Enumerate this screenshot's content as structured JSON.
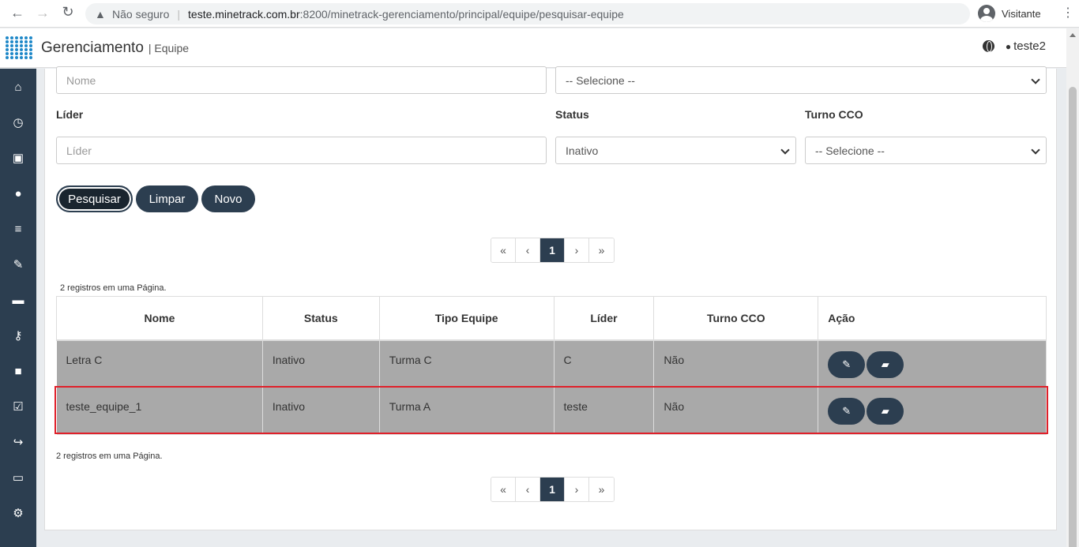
{
  "browser": {
    "security": "Não seguro",
    "url_host": "teste.minetrack.com.br",
    "url_path": ":8200/minetrack-gerenciamento/principal/equipe/pesquisar-equipe",
    "profile": "Visitante"
  },
  "header": {
    "title": "Gerenciamento",
    "subtitle": "| Equipe",
    "user": "teste2"
  },
  "sidebar": {
    "items": [
      {
        "icon": "home-icon",
        "glyph": "⌂"
      },
      {
        "icon": "clock-icon",
        "glyph": "◷"
      },
      {
        "icon": "bus-icon",
        "glyph": "▣"
      },
      {
        "icon": "user-icon",
        "glyph": "●"
      },
      {
        "icon": "menu-icon",
        "glyph": "≡"
      },
      {
        "icon": "wrench-icon",
        "glyph": "✎"
      },
      {
        "icon": "archive-icon",
        "glyph": "▬"
      },
      {
        "icon": "key-icon",
        "glyph": "⚷"
      },
      {
        "icon": "lock-icon",
        "glyph": "■"
      },
      {
        "icon": "check-square-icon",
        "glyph": "☑"
      },
      {
        "icon": "share-icon",
        "glyph": "↪"
      },
      {
        "icon": "money-icon",
        "glyph": "▭"
      },
      {
        "icon": "cogs-icon",
        "glyph": "⚙"
      }
    ]
  },
  "form": {
    "nome_placeholder": "Nome",
    "tipo_value": "-- Selecione --",
    "lider_label": "Líder",
    "lider_placeholder": "Líder",
    "status_label": "Status",
    "status_value": "Inativo",
    "turno_label": "Turno CCO",
    "turno_value": "-- Selecione --"
  },
  "buttons": {
    "search": "Pesquisar",
    "clear": "Limpar",
    "new": "Novo"
  },
  "pagination": {
    "first": "«",
    "prev": "‹",
    "current": "1",
    "next": "›",
    "last": "»"
  },
  "records_text": "2 registros em uma Página.",
  "table": {
    "headers": [
      "Nome",
      "Status",
      "Tipo Equipe",
      "Líder",
      "Turno CCO",
      "Ação"
    ],
    "rows": [
      {
        "nome": "Letra C",
        "status": "Inativo",
        "tipo": "Turma C",
        "lider": "C",
        "turno": "Não"
      },
      {
        "nome": "teste_equipe_1",
        "status": "Inativo",
        "tipo": "Turma A",
        "lider": "teste",
        "turno": "Não"
      }
    ]
  },
  "colors": {
    "primary": "#2c3e50",
    "row_bg": "#a9a9a9",
    "highlight": "#e0202a"
  }
}
